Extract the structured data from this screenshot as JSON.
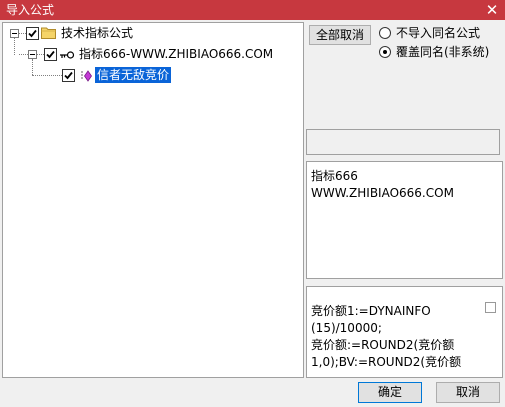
{
  "window": {
    "title": "导入公式",
    "close_glyph": "✕"
  },
  "tree": {
    "root": {
      "label": "技术指标公式",
      "checked": true,
      "icon": "folder-icon"
    },
    "group": {
      "label": "指标666-WWW.ZHIBIAO666.COM",
      "checked": true,
      "icon": "key-icon"
    },
    "formula": {
      "label": "信者无敌竞价",
      "checked": true,
      "selected": true,
      "icon": "formula-icon"
    }
  },
  "controls": {
    "deselect_all_label": "全部取消",
    "radio_no_import_label": "不导入同名公式",
    "radio_overwrite_label": "覆盖同名(非系统)",
    "selected_radio": "overwrite"
  },
  "description": {
    "lines": [
      "指标666",
      "WWW.ZHIBIAO666.COM"
    ]
  },
  "code": {
    "lines": [
      "竞价额1:=DYNAINFO",
      "(15)/10000;",
      "竞价额:=ROUND2(竞价额",
      "1,0);BV:=ROUND2(竞价额"
    ]
  },
  "footer": {
    "ok_label": "确定",
    "cancel_label": "取消"
  },
  "colors": {
    "titlebar": "#c7383f",
    "selection": "#0a64d8"
  }
}
